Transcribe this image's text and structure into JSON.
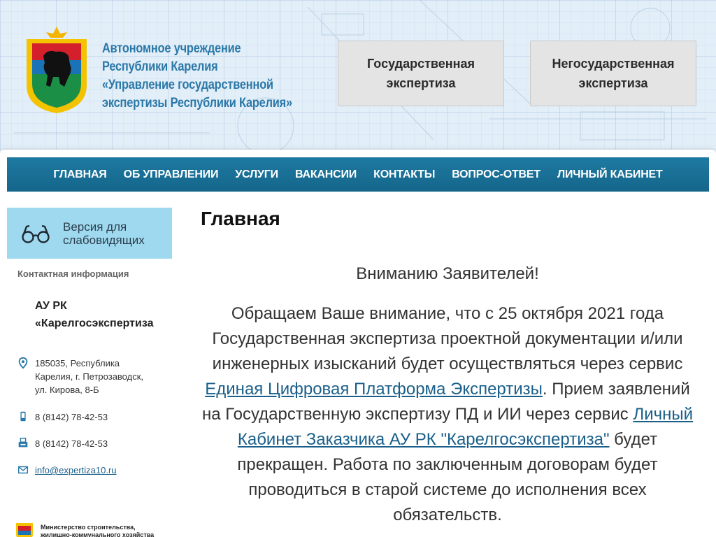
{
  "header": {
    "org_lines": [
      "Автономное учреждение",
      "Республики Карелия",
      "«Управление государственной",
      "экспертизы Республики Карелия»"
    ],
    "gov_button": [
      "Государственная",
      "экспертиза"
    ],
    "nongov_button": [
      "Негосударственная",
      "экспертиза"
    ]
  },
  "nav": {
    "items": [
      "ГЛАВНАЯ",
      "ОБ УПРАВЛЕНИИ",
      "УСЛУГИ",
      "ВАКАНСИИ",
      "КОНТАКТЫ",
      "ВОПРОС-ОТВЕТ",
      "ЛИЧНЫЙ КАБИНЕТ"
    ]
  },
  "sidebar": {
    "vision_label": "Версия для слабовидящих",
    "contact_heading": "Контактная информация",
    "company_name": "АУ РК «Карелгосэкспертиза",
    "address": [
      "185035, Республика",
      "Карелия, г. Петрозаводск,",
      "ул. Кирова, 8-Б"
    ],
    "phone": "8 (8142) 78-42-53",
    "fax": "8 (8142) 78-42-53",
    "email": "info@expertiza10.ru",
    "ministry_lines": [
      "Министерство строительства,",
      "жилищно-коммунального хозяйства"
    ]
  },
  "main": {
    "page_title": "Главная",
    "notice_title": "Вниманию Заявителей!",
    "notice_part1": "Обращаем Ваше внимание, что с 25 октября 2021 года Государственная экспертиза проектной документации и/или инженерных изысканий будет осуществляться через сервис ",
    "link1": "Единая Цифровая Платформа Экспертизы",
    "notice_part2": ". Прием заявлений на Государственную экспертизу ПД и ИИ через сервис ",
    "link2": "Личный Кабинет Заказчика АУ РК \"Карелгосэкспертиза\"",
    "notice_part3": " будет прекращен. Работа по заключенным договорам будет проводиться в старой системе до исполнения всех обязательств."
  },
  "colors": {
    "brand_blue": "#2a78a8",
    "nav_bg": "#1a6f96",
    "vision_bg": "#9fd9f0",
    "link": "#1a5f8a"
  }
}
